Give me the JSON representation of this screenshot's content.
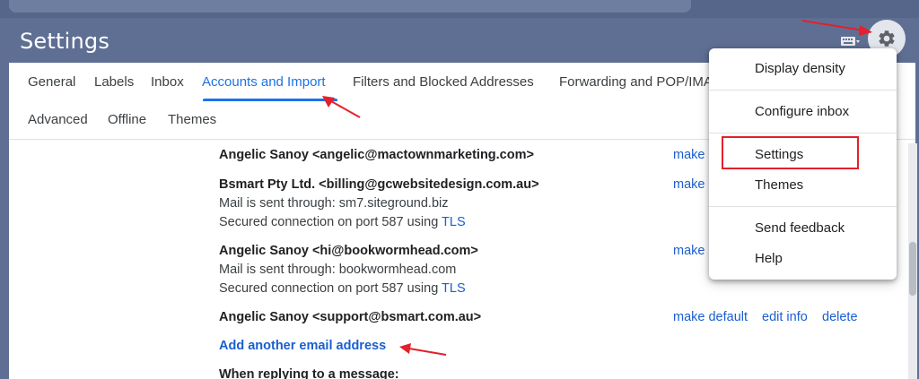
{
  "header": {
    "title": "Settings",
    "keyboard_icon": "keyboard-icon",
    "gear_icon": "gear-icon"
  },
  "tabs": {
    "row1": [
      "General",
      "Labels",
      "Inbox",
      "Accounts and Import",
      "Filters and Blocked Addresses",
      "Forwarding and POP/IMAP"
    ],
    "row2": [
      "Advanced",
      "Offline",
      "Themes"
    ],
    "active": "Accounts and Import"
  },
  "send_mail_as": {
    "accounts": [
      {
        "name": "Angelic Sanoy <angelic@mactownmarketing.com>",
        "action": "make default"
      },
      {
        "name": "Bsmart Pty Ltd. <billing@gcwebsitedesign.com.au>",
        "sent_through": "Mail is sent through: sm7.siteground.biz",
        "secured_prefix": "Secured connection on port 587 using ",
        "secured_link": "TLS",
        "action": "make default"
      },
      {
        "name": "Angelic Sanoy <hi@bookwormhead.com>",
        "sent_through": "Mail is sent through: bookwormhead.com",
        "secured_prefix": "Secured connection on port 587 using ",
        "secured_link": "TLS",
        "action": "make default"
      },
      {
        "name": "Angelic Sanoy <support@bsmart.com.au>",
        "action": "make default",
        "edit": "edit info",
        "delete": "delete"
      }
    ],
    "add_link": "Add another email address",
    "replying_label": "When replying to a message:"
  },
  "menu": {
    "items": [
      "Display density",
      "Configure inbox",
      "Settings",
      "Themes",
      "Send feedback",
      "Help"
    ],
    "highlighted": "Settings"
  },
  "colors": {
    "header_bg": "#5f6f94",
    "accent": "#1a73e8",
    "link": "#1a5fd0",
    "annotation": "#e3202b"
  }
}
